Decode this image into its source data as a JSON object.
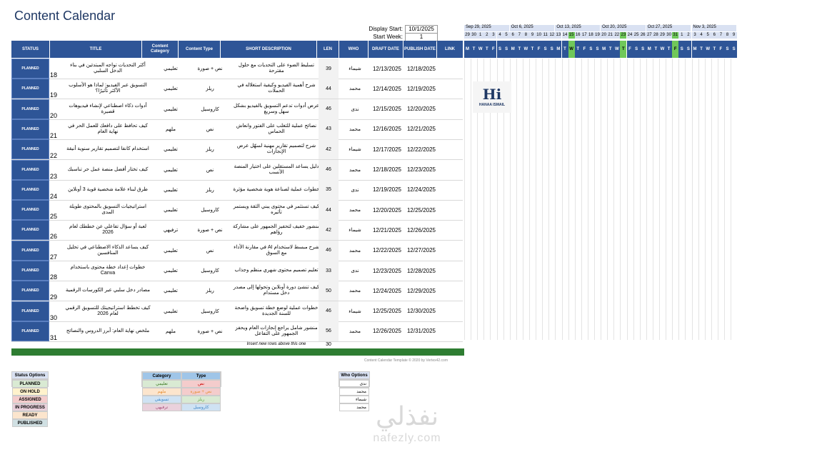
{
  "title": "Content Calendar",
  "display_start_label": "Display Start:",
  "display_start_value": "10/1/2025",
  "start_week_label": "Start Week:",
  "start_week_value": "1",
  "headers": {
    "status": "STATUS",
    "title": "TITLE",
    "category": "Content Category",
    "type": "Content Type",
    "description": "SHORT DESCRIPTION",
    "len": "LEN",
    "who": "WHO",
    "draft": "DRAFT DATE",
    "publish": "PUBLISH DATE",
    "link": "LINK"
  },
  "rows": [
    {
      "status": "PLANNED",
      "num": "18",
      "title": "أكثر التحديات تواجه المبتدئين في بناء الدخل السلبي",
      "category": "تعليمي",
      "type": "نص + صورة",
      "desc": "تسليط الضوء على التحديات مع حلول مقترحة",
      "len": "39",
      "who": "شيماء",
      "draft": "12/13/2025",
      "pub": "12/18/2025"
    },
    {
      "status": "PLANNED",
      "num": "19",
      "title": "التسويق عبر الفيديو: لماذا هو الأسلوب الأكثر تأثيرًا؟",
      "category": "تعليمي",
      "type": "ريلز",
      "desc": "شرح أهمية الفيديو وكيفية استغلاله في الحملات",
      "len": "44",
      "who": "محمد",
      "draft": "12/14/2025",
      "pub": "12/19/2025"
    },
    {
      "status": "PLANNED",
      "num": "20",
      "title": "أدوات ذكاء اصطناعي لإنشاء فيديوهات قصيرة",
      "category": "تعليمي",
      "type": "كاروسيل",
      "desc": "عرض أدوات تدعم التسويق بالفيديو بشكل سهل وسريع",
      "len": "46",
      "who": "ندى",
      "draft": "12/15/2025",
      "pub": "12/20/2025"
    },
    {
      "status": "PLANNED",
      "num": "21",
      "title": "كيف تحافظ على دافعك للعمل الحر في نهاية العام",
      "category": "ملهم",
      "type": "نص",
      "desc": "نصائح عملية للتغلب على الفتور وانعاش الحماس",
      "len": "43",
      "who": "محمد",
      "draft": "12/16/2025",
      "pub": "12/21/2025"
    },
    {
      "status": "PLANNED",
      "num": "22",
      "title": "استخدام كانفا لتصميم تقارير سنوية أنيقة",
      "category": "تعليمي",
      "type": "ريلز",
      "desc": "شرح لتصميم تقارير مهنية لسهّل عرض الإنجازات",
      "len": "42",
      "who": "شيماء",
      "draft": "12/17/2025",
      "pub": "12/22/2025"
    },
    {
      "status": "PLANNED",
      "num": "23",
      "title": "كيف تختار أفضل منصة عمل حر تناسبك",
      "category": "تعليمي",
      "type": "نص",
      "desc": "دليل يساعد المستقلين على اختيار المنصة الأنسب",
      "len": "46",
      "who": "محمد",
      "draft": "12/18/2025",
      "pub": "12/23/2025"
    },
    {
      "status": "PLANNED",
      "num": "24",
      "title": "طرق لبناء علامة شخصية قوية 3 أونلاين",
      "category": "تعليمي",
      "type": "ريلز",
      "desc": "خطوات عملية لصناعة هوية شخصية مؤثرة",
      "len": "35",
      "who": "ندى",
      "draft": "12/19/2025",
      "pub": "12/24/2025"
    },
    {
      "status": "PLANNED",
      "num": "25",
      "title": "استراتيجيات التسويق بالمحتوى طويلة المدى",
      "category": "تعليمي",
      "type": "كاروسيل",
      "desc": "كيف تستثمر في محتوى يبني الثقة ويستمر تأثيره",
      "len": "44",
      "who": "محمد",
      "draft": "12/20/2025",
      "pub": "12/25/2025"
    },
    {
      "status": "PLANNED",
      "num": "26",
      "title": "لعبة أو سؤال تفاعلي عن خططك لعام 2026",
      "category": "ترفيهي",
      "type": "نص + صورة",
      "desc": "منشور خفيف لتحفيز الجمهور على مشاركة رؤاهم",
      "len": "42",
      "who": "شيماء",
      "draft": "12/21/2025",
      "pub": "12/26/2025"
    },
    {
      "status": "PLANNED",
      "num": "27",
      "title": "كيف يساعد الذكاء الاصطناعي في تحليل المنافسين",
      "category": "تعليمي",
      "type": "نص",
      "desc": "شرح مبسط لاستخدام AI في مقارنة الأداء مع السوق",
      "len": "46",
      "who": "محمد",
      "draft": "12/22/2025",
      "pub": "12/27/2025"
    },
    {
      "status": "PLANNED",
      "num": "28",
      "title": "خطوات إعداد خطة محتوى باستخدام Canva",
      "category": "تعليمي",
      "type": "كاروسيل",
      "desc": "تعليم تصميم محتوى شهري منظم وجذاب",
      "len": "33",
      "who": "ندى",
      "draft": "12/23/2025",
      "pub": "12/28/2025"
    },
    {
      "status": "PLANNED",
      "num": "29",
      "title": "مصادر دخل سلبي عبر الكورسات الرقمية",
      "category": "تعليمي",
      "type": "ريلز",
      "desc": "كيف تنشئ دورة أونلاين وتحولها إلى مصدر دخل مستدام",
      "len": "50",
      "who": "محمد",
      "draft": "12/24/2025",
      "pub": "12/29/2025"
    },
    {
      "status": "PLANNED",
      "num": "30",
      "title": "كيف تخطط استراتيجيتك للتسويق الرقمي لعام 2026",
      "category": "تعليمي",
      "type": "كاروسيل",
      "desc": "خطوات عملية لوضع خطة تسويق واضحة للسنة الجديدة",
      "len": "46",
      "who": "شيماء",
      "draft": "12/25/2025",
      "pub": "12/30/2025"
    },
    {
      "status": "PLANNED",
      "num": "31",
      "title": "ملخص نهاية العام: أبرز الدروس والنصائح",
      "category": "ملهم",
      "type": "نص + صورة",
      "desc": "منشور شامل يراجع إنجازات العام ويحفز الجمهور على التفاعل",
      "len": "56",
      "who": "محمد",
      "draft": "12/26/2025",
      "pub": "12/31/2025"
    }
  ],
  "insert_note": "Insert new rows above this one",
  "insert_len": "30",
  "template_credit": "Content Calendar Template © 2020 by Vertex42.com",
  "calendar_weeks": [
    "Sep 29, 2025",
    "Oct 6, 2025",
    "Oct 13, 2025",
    "Oct 20, 2025",
    "Oct 27, 2025",
    "Nov 3, 2025"
  ],
  "calendar_days": [
    "29",
    "30",
    "1",
    "2",
    "3",
    "4",
    "5",
    "6",
    "7",
    "8",
    "9",
    "10",
    "11",
    "12",
    "13",
    "14",
    "15",
    "16",
    "17",
    "18",
    "19",
    "20",
    "21",
    "22",
    "23",
    "24",
    "25",
    "26",
    "27",
    "28",
    "29",
    "30",
    "31",
    "1",
    "2",
    "3",
    "4",
    "5",
    "6",
    "7",
    "8",
    "9"
  ],
  "calendar_letters": [
    "M",
    "T",
    "W",
    "T",
    "F",
    "S",
    "S",
    "M",
    "T",
    "W",
    "T",
    "F",
    "S",
    "S",
    "M",
    "T",
    "W",
    "T",
    "F",
    "S",
    "S",
    "M",
    "T",
    "W",
    "T",
    "F",
    "S",
    "S",
    "M",
    "T",
    "W",
    "T",
    "F",
    "S",
    "S",
    "M",
    "T",
    "W",
    "T",
    "F",
    "S",
    "S"
  ],
  "highlight_days": [
    16,
    24,
    32
  ],
  "logo_text": "HANAA ISMAIL",
  "status_options_title": "Status Options",
  "status_options": [
    {
      "label": "PLANNED",
      "color": "#d9ead3"
    },
    {
      "label": "ON HOLD",
      "color": "#fff2cc"
    },
    {
      "label": "ASSIGNED",
      "color": "#f4cccc"
    },
    {
      "label": "IN PROGRESS",
      "color": "#ead1dc"
    },
    {
      "label": "READY",
      "color": "#fce5cd"
    },
    {
      "label": "PUBLISHED",
      "color": "#d0e0e3"
    }
  ],
  "category_title": "Category",
  "type_title": "Type",
  "categories": [
    {
      "cat": "تعليمي",
      "type": "نص",
      "cat_color": "#d9ead3",
      "type_color": "#f4cccc",
      "cat_text": "#38761d",
      "type_text": "#cc0000"
    },
    {
      "cat": "ملهم",
      "type": "نص + صورة",
      "cat_color": "#fce5cd",
      "type_color": "#f4cccc",
      "cat_text": "#e69138",
      "type_text": "#e69138"
    },
    {
      "cat": "تسويقي",
      "type": "ريلز",
      "cat_color": "#cfe2f3",
      "type_color": "#d9ead3",
      "cat_text": "#3d85c6",
      "type_text": "#6aa84f"
    },
    {
      "cat": "ترفيهي",
      "type": "كاروسيل",
      "cat_color": "#ead1dc",
      "type_color": "#cfe2f3",
      "cat_text": "#a64d79",
      "type_text": "#3d85c6"
    }
  ],
  "who_title": "Who Options",
  "who_options": [
    "ندى",
    "محمد",
    "شيماء",
    "محمد"
  ],
  "watermark": "نفذلي",
  "watermark_en": "nafezly.com"
}
